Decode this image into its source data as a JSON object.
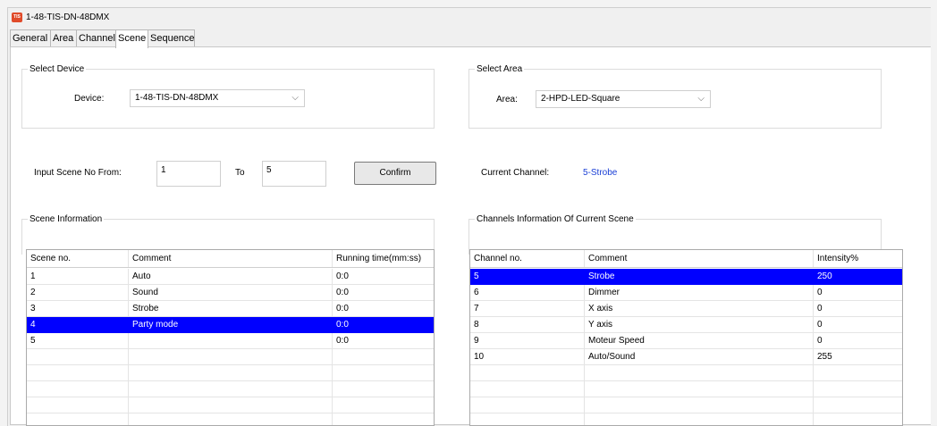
{
  "window": {
    "title": "1-48-TIS-DN-48DMX",
    "icon": "TIS"
  },
  "tabs": [
    {
      "label": "General",
      "active": false
    },
    {
      "label": "Area",
      "active": false
    },
    {
      "label": "Channel",
      "active": false
    },
    {
      "label": "Scene",
      "active": true
    },
    {
      "label": "Sequence",
      "active": false
    }
  ],
  "select_device": {
    "group_title": "Select Device",
    "label": "Device:",
    "value": "1-48-TIS-DN-48DMX"
  },
  "select_area": {
    "group_title": "Select Area",
    "label": "Area:",
    "value": "2-HPD-LED-Square"
  },
  "scene_input": {
    "from_label": "Input Scene No From:",
    "from_value": "1",
    "to_label": "To",
    "to_value": "5",
    "confirm_label": "Confirm"
  },
  "current_channel": {
    "label": "Current Channel:",
    "value": "5-Strobe"
  },
  "scene_info": {
    "group_title": "Scene Information",
    "headers": [
      "Scene no.",
      "Comment",
      "Running time(mm:ss)"
    ],
    "rows": [
      [
        "1",
        "Auto",
        "0:0"
      ],
      [
        "2",
        "Sound",
        "0:0"
      ],
      [
        "3",
        "Strobe",
        "0:0"
      ],
      [
        "4",
        "Party mode",
        "0:0"
      ],
      [
        "5",
        "",
        "0:0"
      ]
    ],
    "selected_row": 3
  },
  "channel_info": {
    "group_title": "Channels Information Of Current Scene",
    "headers": [
      "Channel no.",
      "Comment",
      "Intensity%"
    ],
    "rows": [
      [
        "5",
        "Strobe",
        "250"
      ],
      [
        "6",
        "Dimmer",
        "0"
      ],
      [
        "7",
        "X axis",
        "0"
      ],
      [
        "8",
        "Y axis",
        "0"
      ],
      [
        "9",
        "Moteur Speed",
        "0"
      ],
      [
        "10",
        "Auto/Sound",
        "255"
      ]
    ],
    "selected_row": 0
  },
  "colors": {
    "selection": "#0000ff",
    "accent_text": "#1a3fd6",
    "app_icon": "#e04b2a"
  }
}
